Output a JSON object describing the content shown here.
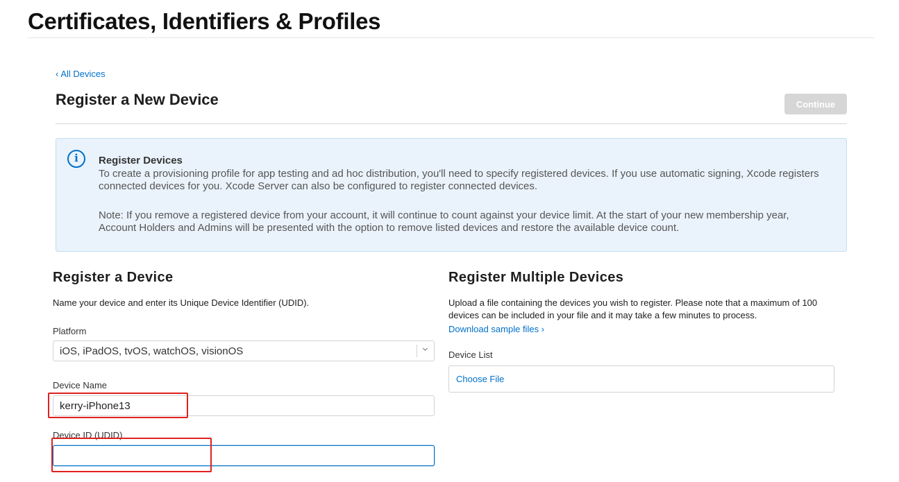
{
  "page": {
    "title": "Certificates, Identifiers & Profiles"
  },
  "nav": {
    "back_chevron": "‹",
    "back_label": "All Devices"
  },
  "header": {
    "heading": "Register a New Device",
    "continue_label": "Continue"
  },
  "info": {
    "icon": "info-icon",
    "icon_glyph": "i",
    "title": "Register Devices",
    "paragraph1": "To create a provisioning profile for app testing and ad hoc distribution, you'll need to specify registered devices. If you use automatic signing, Xcode registers connected devices for you. Xcode Server can also be configured to register connected devices.",
    "paragraph2": "Note: If you remove a registered device from your account, it will continue to count against your device limit. At the start of your new membership year, Account Holders and Admins will be presented with the option to remove listed devices and restore the available device count."
  },
  "single": {
    "heading": "Register a Device",
    "description": "Name your device and enter its Unique Device Identifier (UDID).",
    "platform_label": "Platform",
    "platform_value": "iOS, iPadOS, tvOS, watchOS, visionOS",
    "device_name_label": "Device Name",
    "device_name_value": "kerry-iPhone13",
    "device_id_label": "Device ID (UDID)",
    "device_id_value": ""
  },
  "multiple": {
    "heading": "Register Multiple Devices",
    "description": "Upload a file containing the devices you wish to register. Please note that a maximum of 100 devices can be included in your file and it may take a few minutes to process.",
    "download_link": "Download sample files",
    "download_chevron": "›",
    "device_list_label": "Device List",
    "choose_file_label": "Choose File"
  },
  "colors": {
    "accent": "#0070c9",
    "info_background": "#eaf3fb",
    "disabled_button": "#d6d6d6",
    "annotation_red": "#e0201c"
  }
}
